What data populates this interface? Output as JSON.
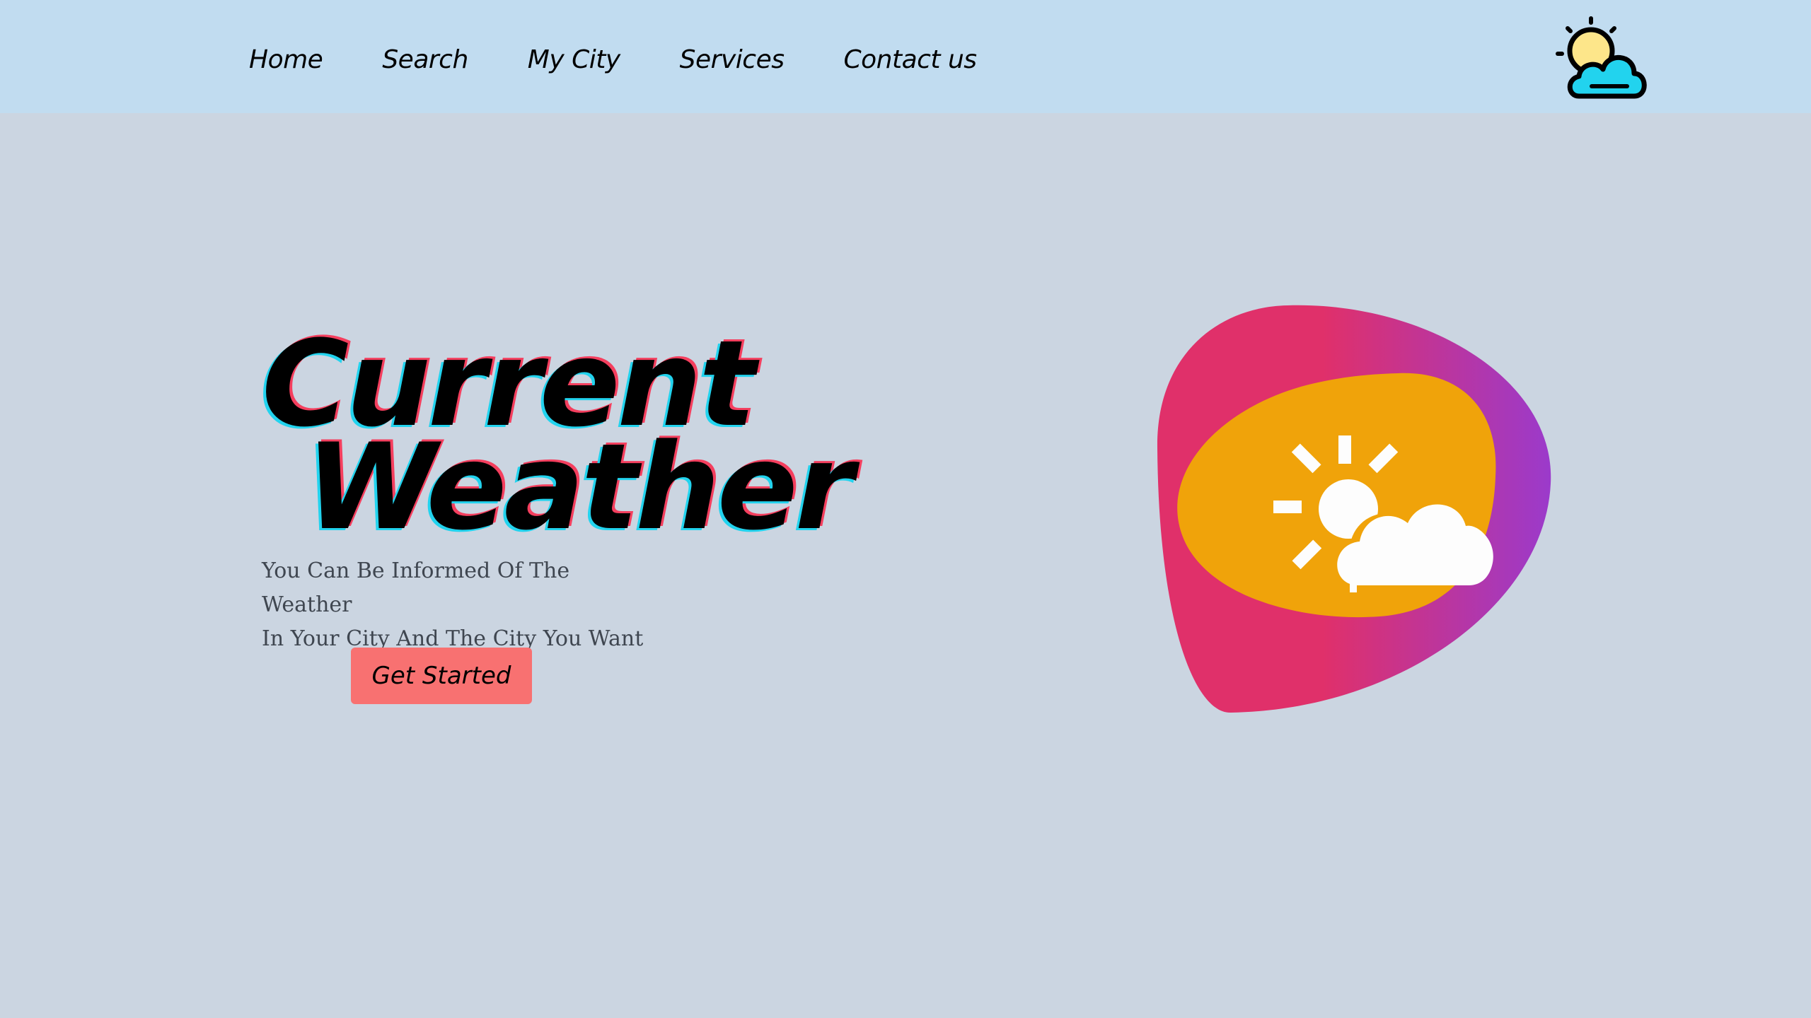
{
  "nav": {
    "items": [
      {
        "label": "Home"
      },
      {
        "label": "Search"
      },
      {
        "label": "My City"
      },
      {
        "label": "Services"
      },
      {
        "label": "Contact us"
      }
    ],
    "logo_icon": "sun-cloud-icon"
  },
  "hero": {
    "title_line1": "Current",
    "title_line2": "Weather",
    "subtitle_line1": "You Can Be Informed Of The Weather",
    "subtitle_line2": "In Your City And The City You Want",
    "cta_label": "Get Started",
    "illustration_icon": "partly-sunny-icon"
  },
  "colors": {
    "nav_bg": "#c1dcf0",
    "page_bg": "#cbd5e1",
    "cta_bg": "#f87171",
    "blob_pink": "#e0306a",
    "blob_purple": "#9b3acb",
    "blob_orange": "#f0a30a",
    "logo_cloud": "#22d3ee",
    "logo_sun": "#fde68a"
  }
}
